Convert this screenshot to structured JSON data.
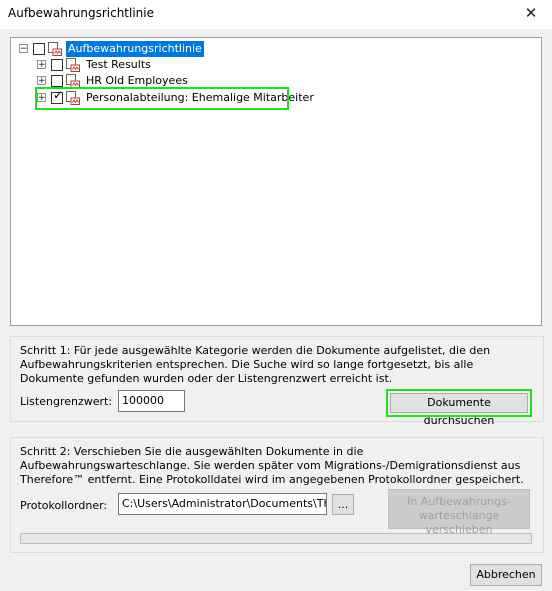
{
  "window": {
    "title": "Aufbewahrungsrichtlinie",
    "close_glyph": "✕"
  },
  "tree": {
    "root": {
      "label": "Aufbewahrungsrichtlinie",
      "checked": false,
      "selected": true
    },
    "children": [
      {
        "label": "Test Results",
        "checked": false
      },
      {
        "label": "HR Old Employees",
        "checked": false
      },
      {
        "label": "Personalabteilung: Ehemalige Mitarbeiter",
        "checked": true
      }
    ],
    "expander_glyph": "+",
    "collapse_glyph": "−",
    "check_glyph": "✓"
  },
  "step1": {
    "description": "Schritt 1: Für jede ausgewählte Kategorie werden die Dokumente aufgelistet, die den Aufbewahrungskriterien entsprechen. Die Suche wird so lange fortgesetzt, bis alle Dokumente gefunden wurden oder der Listengrenzwert erreicht ist.",
    "limit_label": "Listengrenzwert:",
    "limit_value": "100000",
    "search_button": "Dokumente durchsuchen"
  },
  "step2": {
    "description": "Schritt 2: Verschieben Sie die ausgewählten Dokumente in die Aufbewahrungswarteschlange. Sie werden später vom Migrations-/Demigrationsdienst aus Therefore™ entfernt. Eine Protokolldatei wird im angegebenen Protokollordner gespeichert.",
    "folder_label": "Protokollordner:",
    "folder_value": "C:\\Users\\Administrator\\Documents\\Therefore",
    "browse_button": "...",
    "move_button": "In Aufbewahrungs-warteschlange verschieben",
    "progress": 0
  },
  "footer": {
    "cancel_button": "Abbrechen"
  },
  "colors": {
    "selection": "#0078d7",
    "highlight": "#22dd22",
    "icon_red": "#c0392b"
  }
}
